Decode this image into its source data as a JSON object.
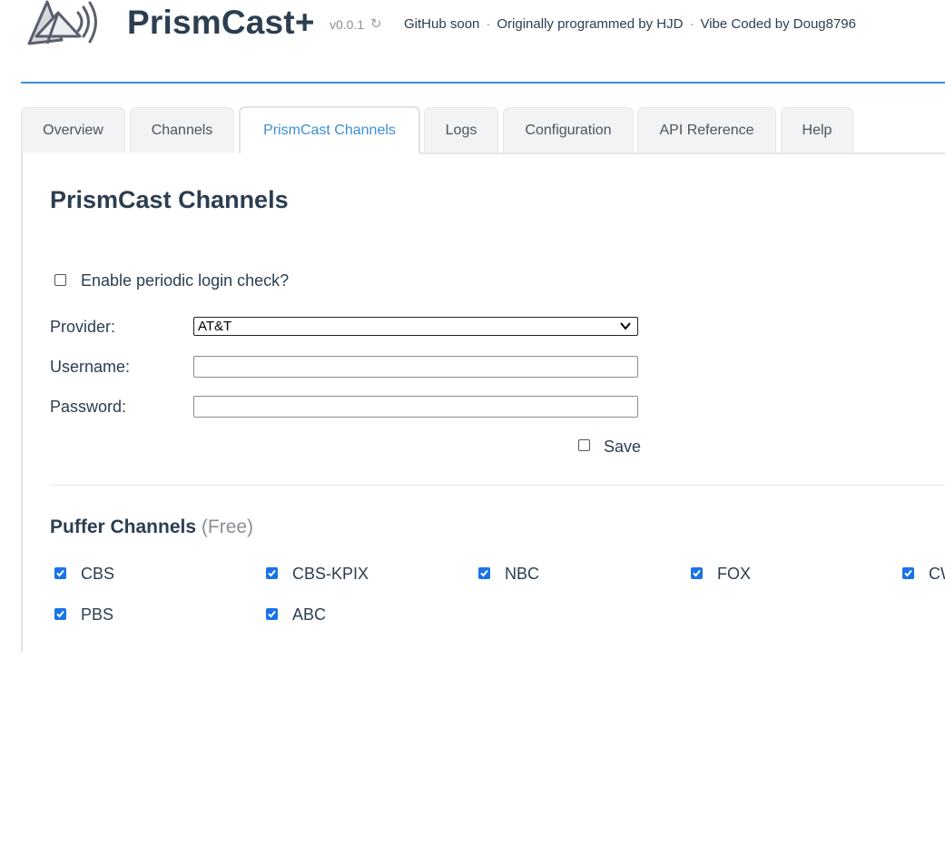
{
  "header": {
    "brand": "PrismCast+",
    "version": "v0.0.1",
    "refresh_icon": "refresh-icon",
    "links": [
      "GitHub soon",
      "Originally programmed by HJD",
      "Vibe Coded by Doug8796"
    ],
    "separator": "·"
  },
  "tabs": [
    {
      "label": "Overview",
      "active": false
    },
    {
      "label": "Channels",
      "active": false
    },
    {
      "label": "PrismCast Channels",
      "active": true
    },
    {
      "label": "Logs",
      "active": false
    },
    {
      "label": "Configuration",
      "active": false
    },
    {
      "label": "API Reference",
      "active": false
    },
    {
      "label": "Help",
      "active": false
    }
  ],
  "panel": {
    "title": "PrismCast Channels",
    "login_check": {
      "label": "Enable periodic login check?",
      "checked": false
    },
    "provider": {
      "label": "Provider:",
      "value": "AT&T"
    },
    "username": {
      "label": "Username:",
      "value": ""
    },
    "password": {
      "label": "Password:",
      "value": ""
    },
    "save": {
      "label": "Save",
      "checked": false
    }
  },
  "puffer": {
    "title": "Puffer Channels",
    "subtitle": "(Free)",
    "channels": [
      {
        "name": "CBS",
        "checked": true
      },
      {
        "name": "CBS-KPIX",
        "checked": true
      },
      {
        "name": "NBC",
        "checked": true
      },
      {
        "name": "FOX",
        "checked": true
      },
      {
        "name": "CW",
        "checked": true
      },
      {
        "name": "PBS",
        "checked": true
      },
      {
        "name": "ABC",
        "checked": true
      }
    ]
  },
  "colors": {
    "accent": "#3c8fd4",
    "text": "#2c3e50",
    "checkbox": "#1a73e8"
  }
}
